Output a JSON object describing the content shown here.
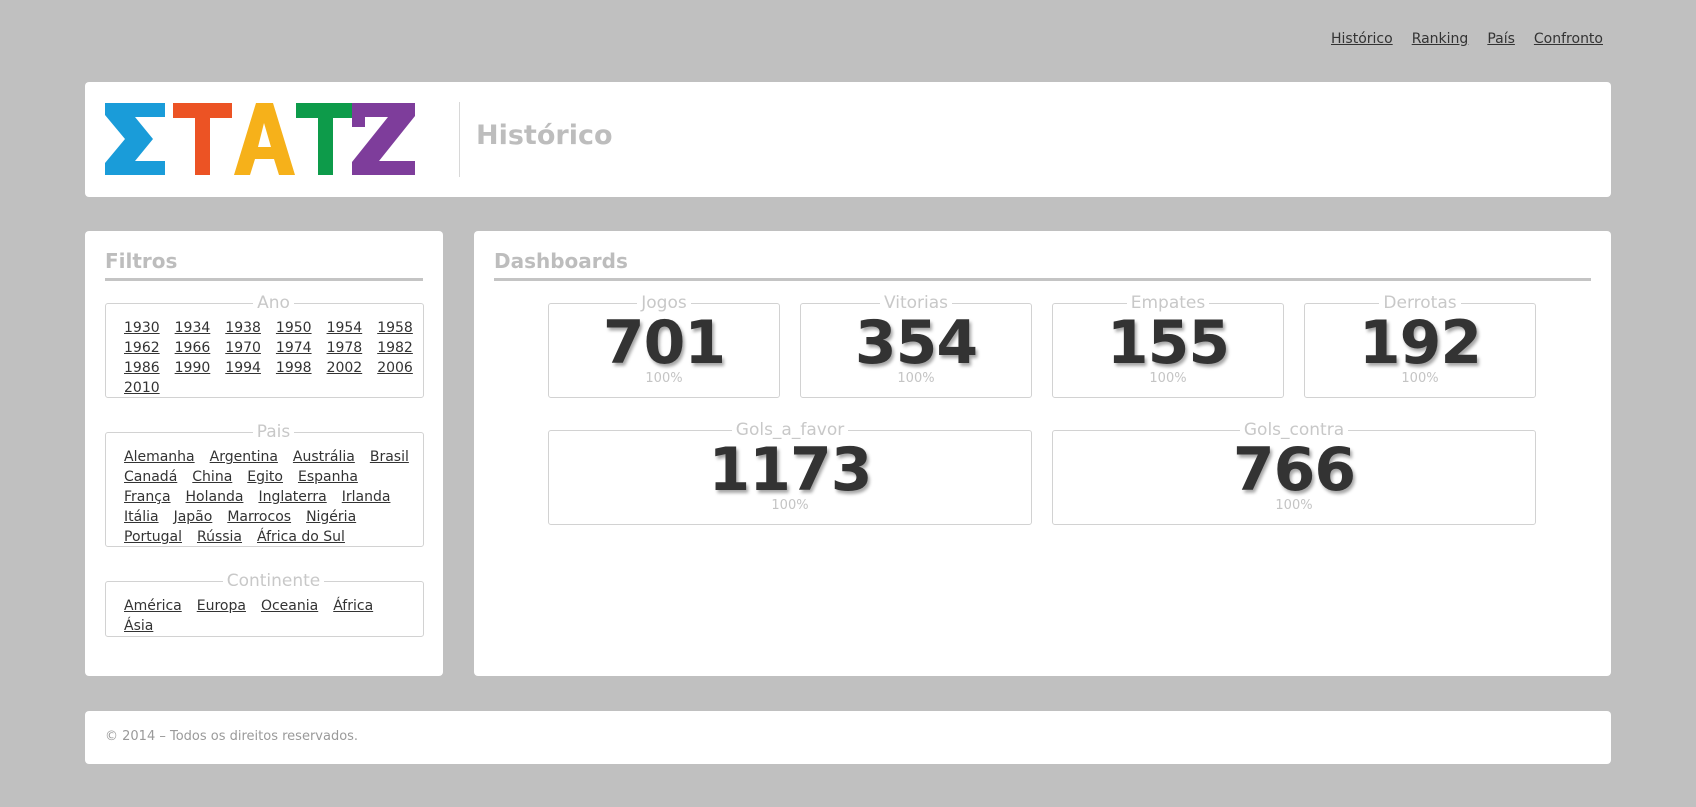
{
  "nav": {
    "items": [
      "Histórico",
      "Ranking",
      "País",
      "Confronto"
    ]
  },
  "header": {
    "logo_text": "ΣTATZ",
    "logo_colors": [
      "#1a9cd9",
      "#ec5324",
      "#f6b11a",
      "#0d9b4a",
      "#7e3d9b"
    ],
    "title": "Histórico"
  },
  "filters": {
    "title": "Filtros",
    "groups": {
      "ano": {
        "legend": "Ano",
        "items": [
          "1930",
          "1934",
          "1938",
          "1950",
          "1954",
          "1958",
          "1962",
          "1966",
          "1970",
          "1974",
          "1978",
          "1982",
          "1986",
          "1990",
          "1994",
          "1998",
          "2002",
          "2006",
          "2010"
        ]
      },
      "pais": {
        "legend": "Pais",
        "items": [
          "Alemanha",
          "Argentina",
          "Austrália",
          "Brasil",
          "Canadá",
          "China",
          "Egito",
          "Espanha",
          "França",
          "Holanda",
          "Inglaterra",
          "Irlanda",
          "Itália",
          "Japão",
          "Marrocos",
          "Nigéria",
          "Portugal",
          "Rússia",
          "África do Sul"
        ]
      },
      "continente": {
        "legend": "Continente",
        "items": [
          "América",
          "Europa",
          "Oceania",
          "África",
          "Ásia"
        ]
      }
    }
  },
  "dashboards": {
    "title": "Dashboards",
    "stats": {
      "jogos": {
        "label": "Jogos",
        "value": "701",
        "pct": "100%"
      },
      "vitorias": {
        "label": "Vitorias",
        "value": "354",
        "pct": "100%"
      },
      "empates": {
        "label": "Empates",
        "value": "155",
        "pct": "100%"
      },
      "derrotas": {
        "label": "Derrotas",
        "value": "192",
        "pct": "100%"
      },
      "gols_a_favor": {
        "label": "Gols_a_favor",
        "value": "1173",
        "pct": "100%"
      },
      "gols_contra": {
        "label": "Gols_contra",
        "value": "766",
        "pct": "100%"
      }
    }
  },
  "footer": {
    "text": "© 2014 – Todos os direitos reservados."
  }
}
